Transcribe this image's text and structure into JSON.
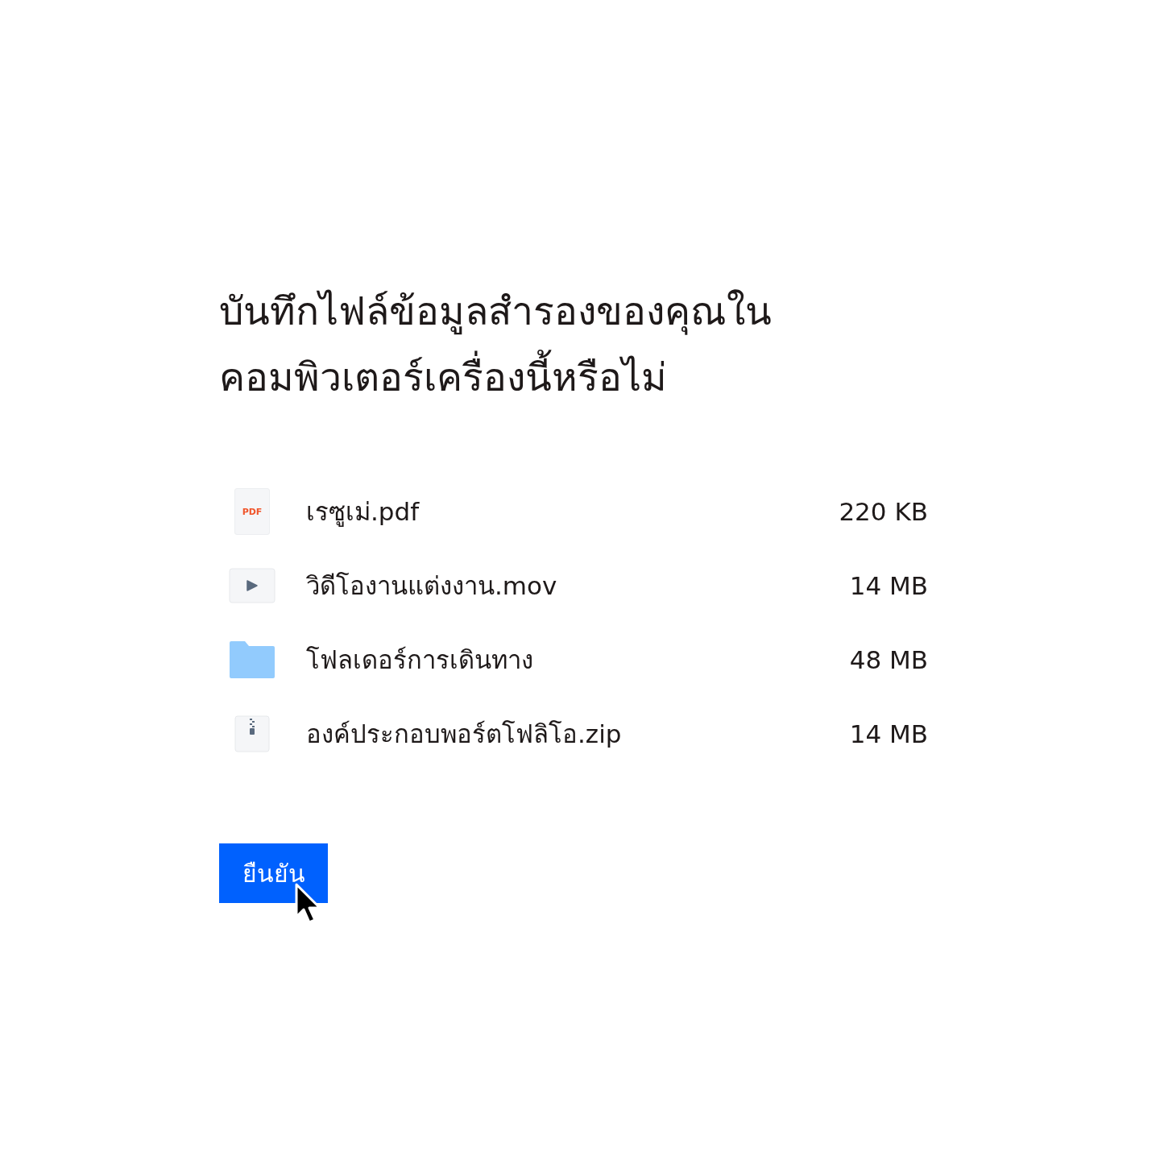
{
  "title": "บันทึกไฟล์ข้อมูลสำรองของคุณในคอมพิวเตอร์เครื่องนี้หรือไม่",
  "files": [
    {
      "kind": "pdf",
      "badge": "PDF",
      "name": "เรซูเม่.pdf",
      "size": "220 KB"
    },
    {
      "kind": "video",
      "name": "วิดีโองานแต่งงาน.mov",
      "size": "14 MB"
    },
    {
      "kind": "folder",
      "name": "โฟลเดอร์การเดินทาง",
      "size": "48 MB"
    },
    {
      "kind": "zip",
      "name": "องค์ประกอบพอร์ตโฟลิโอ.zip",
      "size": "14 MB"
    }
  ],
  "confirm_button": "ยืนยัน"
}
